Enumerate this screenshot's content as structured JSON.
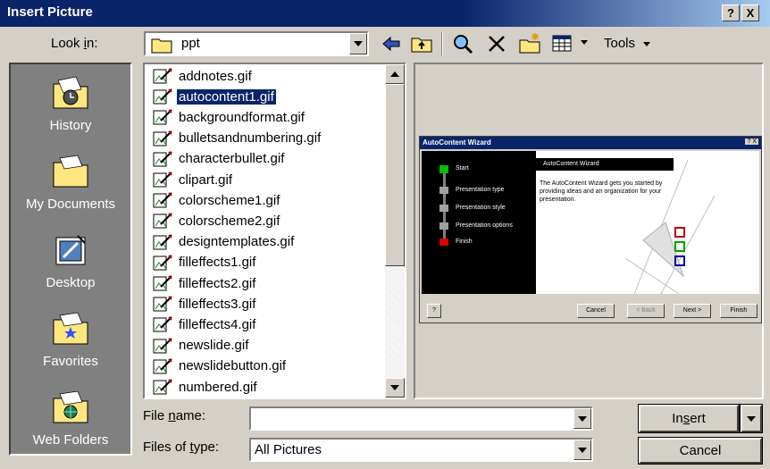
{
  "window": {
    "title": "Insert Picture",
    "help_button": "?",
    "close_button": "X"
  },
  "toolbar": {
    "look_in_label": "Look in:",
    "look_in_value": "ppt",
    "tools_label": "Tools"
  },
  "places": [
    {
      "label": "History",
      "icon": "history-folder-icon"
    },
    {
      "label": "My Documents",
      "icon": "my-documents-folder-icon"
    },
    {
      "label": "Desktop",
      "icon": "desktop-icon"
    },
    {
      "label": "Favorites",
      "icon": "favorites-folder-icon"
    },
    {
      "label": "Web Folders",
      "icon": "web-folders-icon"
    }
  ],
  "files": [
    "addnotes.gif",
    "autocontent1.gif",
    "backgroundformat.gif",
    "bulletsandnumbering.gif",
    "characterbullet.gif",
    "clipart.gif",
    "colorscheme1.gif",
    "colorscheme2.gif",
    "designtemplates.gif",
    "filleffects1.gif",
    "filleffects2.gif",
    "filleffects3.gif",
    "filleffects4.gif",
    "newslide.gif",
    "newslidebutton.gif",
    "numbered.gif"
  ],
  "selected_file": "autocontent1.gif",
  "preview": {
    "title": "AutoContent Wizard",
    "heading": "AutoContent Wizard",
    "body": "The AutoContent Wizard gets you started by providing ideas and an organization for your presentation.",
    "steps": [
      "Start",
      "Presentation type",
      "Presentation style",
      "Presentation options",
      "Finish"
    ],
    "buttons": [
      "Cancel",
      "< Back",
      "Next >",
      "Finish"
    ]
  },
  "form": {
    "file_name_label": "File name:",
    "file_name_value": "",
    "files_of_type_label": "Files of type:",
    "files_of_type_value": "All Pictures"
  },
  "buttons": {
    "insert": "Insert",
    "cancel": "Cancel"
  },
  "colors": {
    "title_bar": "#0a246a",
    "selection": "#0a246a",
    "dialog_bg": "#d4d0c8",
    "places_bg": "#808080"
  }
}
